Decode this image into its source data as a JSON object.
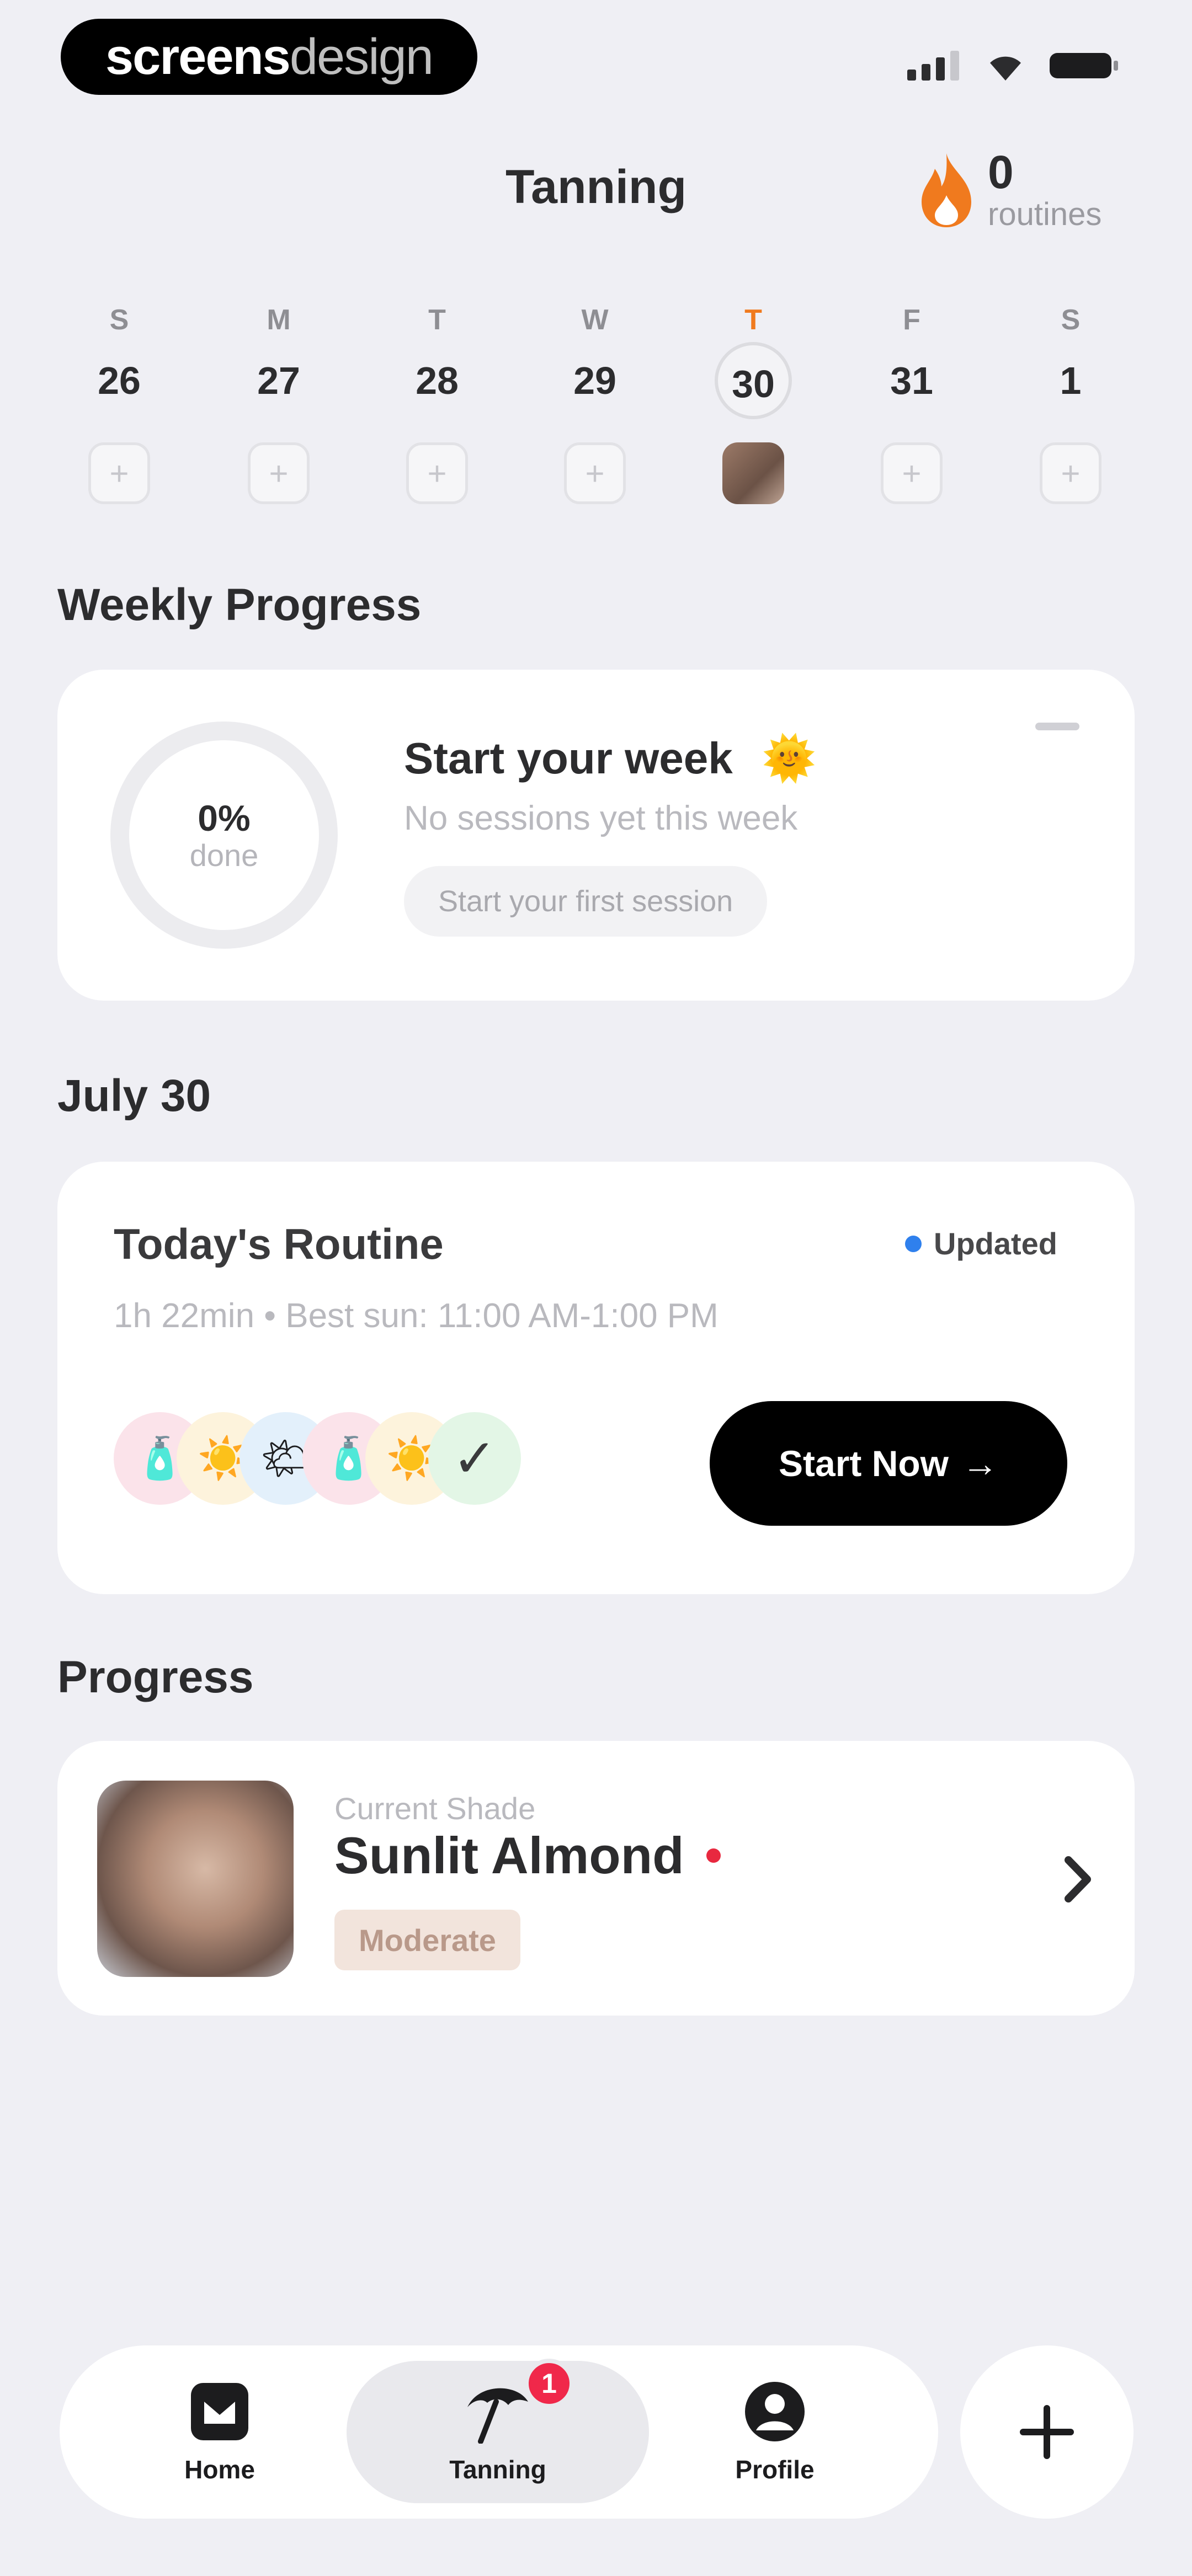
{
  "status_bar": {
    "brand_bold": "screens",
    "brand_light": "design",
    "icons": [
      "signal-icon",
      "wifi-icon",
      "battery-icon"
    ]
  },
  "header": {
    "title": "Tanning",
    "streak_count": "0",
    "streak_label": "routines"
  },
  "calendar": {
    "days": [
      {
        "dow": "S",
        "date": "26"
      },
      {
        "dow": "M",
        "date": "27"
      },
      {
        "dow": "T",
        "date": "28"
      },
      {
        "dow": "W",
        "date": "29"
      },
      {
        "dow": "T",
        "date": "30"
      },
      {
        "dow": "F",
        "date": "31"
      },
      {
        "dow": "S",
        "date": "1"
      }
    ],
    "slot_plus": "+"
  },
  "weekly_progress": {
    "section_title": "Weekly Progress",
    "percent": "0%",
    "percent_label": "done",
    "title": "Start your week",
    "emoji": "🌞",
    "subtitle": "No sessions yet this week",
    "chip": "Start your first session"
  },
  "today": {
    "section_title": "July 30",
    "routine_title": "Today's Routine",
    "badge": "Updated",
    "meta": "1h 22min  •  Best sun: 11:00 AM-1:00 PM",
    "step_icons": [
      "🧴",
      "☀️",
      "🌤",
      "🧴",
      "☀️",
      "✓"
    ],
    "start_button": "Start Now",
    "arrow": "→"
  },
  "progress": {
    "section_title": "Progress",
    "label": "Current Shade",
    "shade_name": "Sunlit Almond",
    "tag": "Moderate"
  },
  "tabbar": {
    "tabs": [
      {
        "label": "Home"
      },
      {
        "label": "Tanning",
        "badge": "1"
      },
      {
        "label": "Profile"
      }
    ],
    "fab_symbol": "+"
  },
  "colors": {
    "accent_orange": "#f07a1e",
    "badge_blue": "#2f80ed",
    "notification_red": "#f0284a",
    "background": "#efeff4"
  }
}
